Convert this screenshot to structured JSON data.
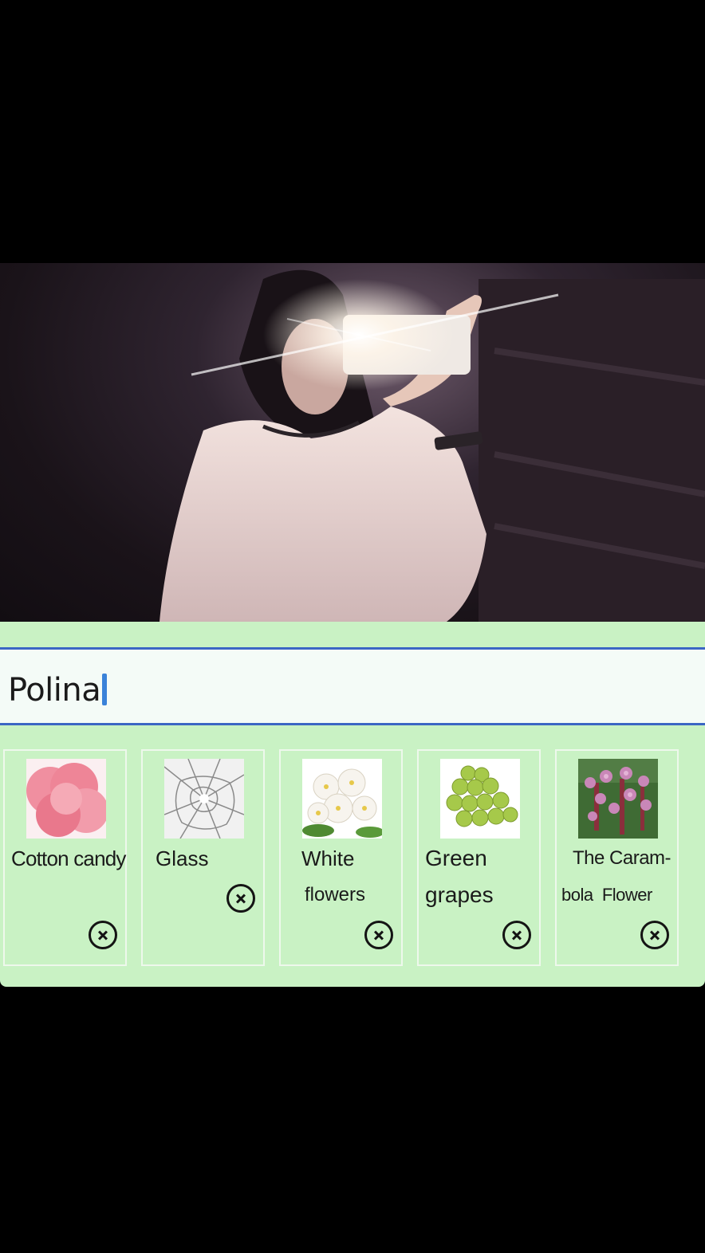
{
  "name_field": {
    "value": "Polina"
  },
  "scents": [
    {
      "label": "Cotton candy",
      "icon": "cotton-candy-image",
      "remove_icon": "close-circle-icon"
    },
    {
      "label": "Glass",
      "icon": "shattered-glass-image",
      "remove_icon": "close-circle-icon"
    },
    {
      "label_line1": "White",
      "label_line2": "flowers",
      "icon": "white-flowers-image",
      "remove_icon": "close-circle-icon"
    },
    {
      "label_line1": "Green",
      "label_line2": "grapes",
      "icon": "green-grapes-image",
      "remove_icon": "close-circle-icon"
    },
    {
      "label_line1": "The Caram-",
      "label_line2": "bola  Flower",
      "icon": "carambola-flower-image",
      "remove_icon": "close-circle-icon"
    }
  ],
  "colors": {
    "panel_background": "#c9f2c4",
    "field_border": "#3b66c4",
    "cursor": "#3a82d9"
  }
}
